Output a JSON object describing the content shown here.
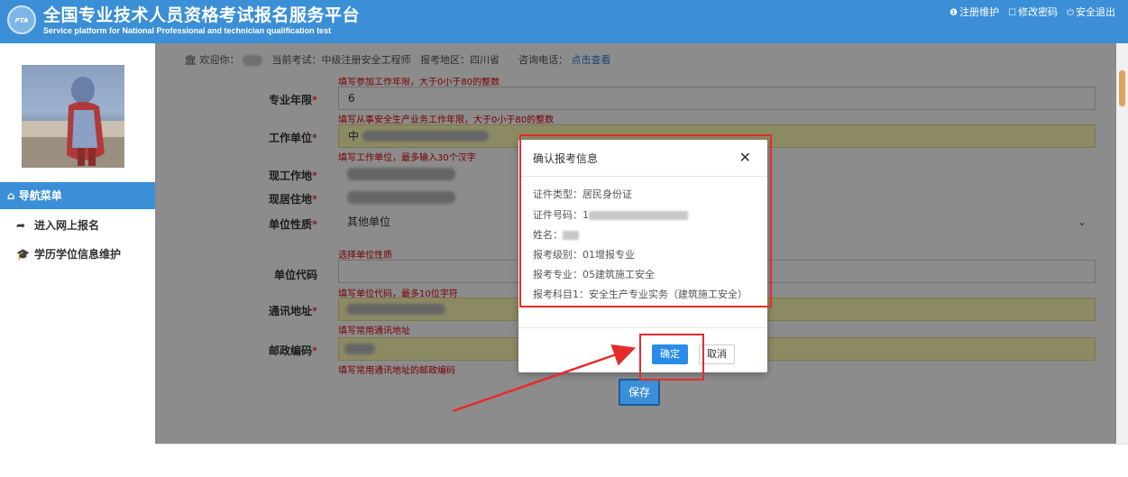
{
  "header": {
    "title_cn": "全国专业技术人员资格考试报名服务平台",
    "title_en": "Service platform for National Professional and technician qualification test",
    "logo_text": "PTA",
    "links": [
      "注册维护",
      "修改密码",
      "安全退出"
    ]
  },
  "infobar": {
    "welcome": "欢迎你：",
    "current_exam": "当前考试：中级注册安全工程师",
    "region": "报考地区：四川省",
    "phone_label": "咨询电话：",
    "phone_link": "点击查看"
  },
  "sidebar": {
    "nav_header": "导航菜单",
    "items": [
      {
        "label": "进入网上报名"
      },
      {
        "label": "学历学位信息维护"
      }
    ]
  },
  "form": {
    "top_hint": "填写参加工作年限，大于0小于80的整数",
    "years_label": "专业年限",
    "years_value": "6",
    "years_hint": "填写从事安全生产业务工作年限，大于0小于80的整数",
    "company_label": "工作单位",
    "company_value": "中",
    "company_hint": "填写工作单位，最多输入30个汉字",
    "current_work_label": "现工作地",
    "current_home_label": "现居住地",
    "unit_type_label": "单位性质",
    "unit_type_value": "其他单位",
    "unit_type_hint": "选择单位性质",
    "unit_code_label": "单位代码",
    "unit_code_hint": "填写单位代码，最多10位字符",
    "address_label": "通讯地址",
    "address_hint": "填写常用通讯地址",
    "postcode_label": "邮政编码",
    "postcode_hint": "填写常用通讯地址的邮政编码",
    "save_label": "保存"
  },
  "modal": {
    "title": "确认报考信息",
    "id_type": "证件类型：居民身份证",
    "id_number_label": "证件号码：1",
    "name_label": "姓名：",
    "level": "报考级别：01增报专业",
    "major": "报考专业：05建筑施工安全",
    "subject": "报考科目1：安全生产专业实务（建筑施工安全）",
    "ok_label": "确定",
    "cancel_label": "取消"
  },
  "colors": {
    "brand_blue": "#3b8fd6",
    "annotation_red": "#e52c2c",
    "hint_red": "#dd0000",
    "field_yellow": "#fffbb5"
  }
}
